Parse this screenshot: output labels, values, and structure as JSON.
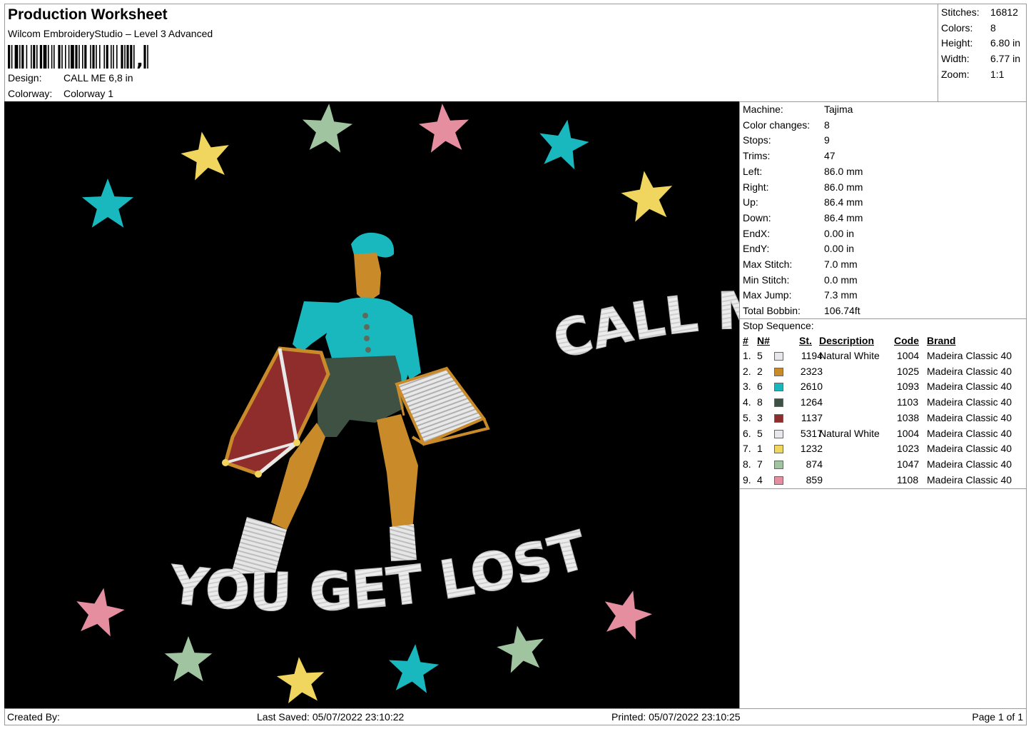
{
  "header": {
    "title": "Production Worksheet",
    "software": "Wilcom EmbroideryStudio – Level 3 Advanced",
    "design_label": "Design:",
    "design_value": "CALL ME 6,8 in",
    "colorway_label": "Colorway:",
    "colorway_value": "Colorway 1"
  },
  "stats": [
    {
      "label": "Stitches:",
      "value": "16812"
    },
    {
      "label": "Colors:",
      "value": "8"
    },
    {
      "label": "Height:",
      "value": "6.80 in"
    },
    {
      "label": "Width:",
      "value": "6.77 in"
    },
    {
      "label": "Zoom:",
      "value": "1:1"
    }
  ],
  "machine_info": [
    {
      "label": "Machine:",
      "value": "Tajima"
    },
    {
      "label": "Color changes:",
      "value": "8"
    },
    {
      "label": "Stops:",
      "value": "9"
    },
    {
      "label": "Trims:",
      "value": "47"
    },
    {
      "label": "Left:",
      "value": "86.0 mm"
    },
    {
      "label": "Right:",
      "value": "86.0 mm"
    },
    {
      "label": "Up:",
      "value": "86.4 mm"
    },
    {
      "label": "Down:",
      "value": "86.4 mm"
    },
    {
      "label": "EndX:",
      "value": "0.00 in"
    },
    {
      "label": "EndY:",
      "value": "0.00 in"
    },
    {
      "label": "Max Stitch:",
      "value": "7.0 mm"
    },
    {
      "label": "Min Stitch:",
      "value": "0.0 mm"
    },
    {
      "label": "Max Jump:",
      "value": "7.3 mm"
    },
    {
      "label": "Total Bobbin:",
      "value": "106.74ft"
    }
  ],
  "stop_sequence": {
    "title": "Stop Sequence:",
    "columns": {
      "num": "#",
      "needle": "N#",
      "stitches": "St.",
      "description": "Description",
      "code": "Code",
      "brand": "Brand"
    },
    "rows": [
      {
        "num": "1.",
        "needle": "5",
        "color": "#e8e8ec",
        "stitches": "1194",
        "description": "Natural White",
        "code": "1004",
        "brand": "Madeira Classic 40"
      },
      {
        "num": "2.",
        "needle": "2",
        "color": "#c98a2a",
        "stitches": "2323",
        "description": "",
        "code": "1025",
        "brand": "Madeira Classic 40"
      },
      {
        "num": "3.",
        "needle": "6",
        "color": "#19b8bf",
        "stitches": "2610",
        "description": "",
        "code": "1093",
        "brand": "Madeira Classic 40"
      },
      {
        "num": "4.",
        "needle": "8",
        "color": "#3e5142",
        "stitches": "1264",
        "description": "",
        "code": "1103",
        "brand": "Madeira Classic 40"
      },
      {
        "num": "5.",
        "needle": "3",
        "color": "#8f2c2c",
        "stitches": "1137",
        "description": "",
        "code": "1038",
        "brand": "Madeira Classic 40"
      },
      {
        "num": "6.",
        "needle": "5",
        "color": "#e8e8ec",
        "stitches": "5317",
        "description": "Natural White",
        "code": "1004",
        "brand": "Madeira Classic 40"
      },
      {
        "num": "7.",
        "needle": "1",
        "color": "#f0d65e",
        "stitches": "1232",
        "description": "",
        "code": "1023",
        "brand": "Madeira Classic 40"
      },
      {
        "num": "8.",
        "needle": "7",
        "color": "#9fc49f",
        "stitches": "874",
        "description": "",
        "code": "1047",
        "brand": "Madeira Classic 40"
      },
      {
        "num": "9.",
        "needle": "4",
        "color": "#e58ea0",
        "stitches": "859",
        "description": "",
        "code": "1108",
        "brand": "Madeira Classic 40"
      }
    ]
  },
  "design_image": {
    "text_top": "CALL ME IF",
    "text_bottom": "YOU GET LOST",
    "background": "#000000"
  },
  "footer": {
    "created_by": "Created By:",
    "last_saved": "Last Saved: 05/07/2022 23:10:22",
    "printed": "Printed: 05/07/2022 23:10:25",
    "page": "Page 1 of 1"
  }
}
